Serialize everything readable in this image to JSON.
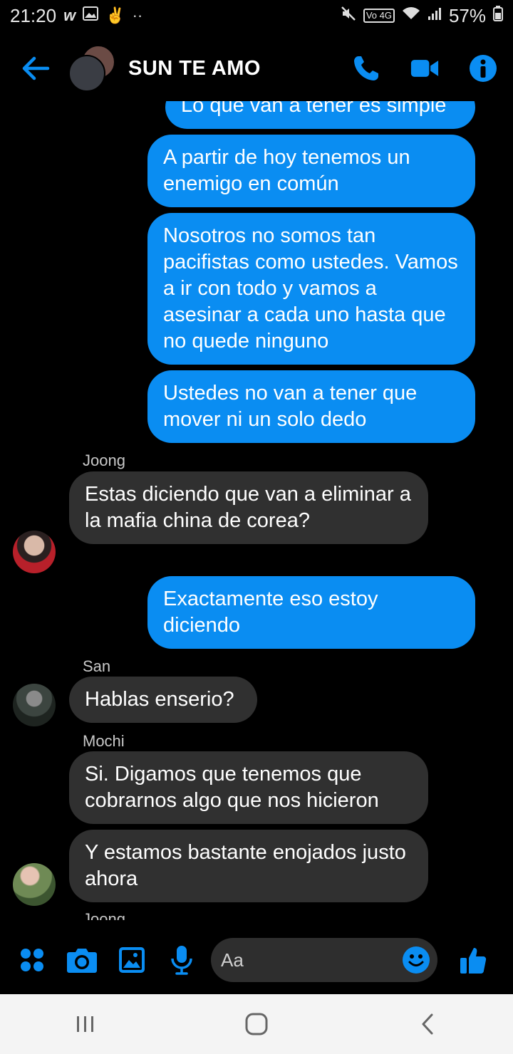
{
  "status_bar": {
    "time": "21:20",
    "battery": "57%",
    "network_badge": "Vo 4G",
    "left_icons": [
      "w-icon",
      "gallery-icon",
      "peace-hand-icon",
      "more-dots-icon"
    ],
    "right_icons": [
      "mute-icon",
      "volte-icon",
      "wifi-icon",
      "signal-icon",
      "battery-icon"
    ]
  },
  "header": {
    "title": "SUN TE AMO",
    "accent": "#0a8df2"
  },
  "messages": [
    {
      "dir": "out",
      "text": "Lo que van a tener es simple"
    },
    {
      "dir": "out",
      "text": "A partir de hoy tenemos un enemigo en común"
    },
    {
      "dir": "out",
      "text": "Nosotros no somos tan pacifistas como ustedes. Vamos a ir con todo y vamos a asesinar a cada uno hasta que no quede ninguno"
    },
    {
      "dir": "out",
      "text": "Ustedes no van a tener que mover ni un solo dedo"
    },
    {
      "dir": "in",
      "sender": "Joong",
      "text": "Estas diciendo que van a eliminar a la mafia china de corea?"
    },
    {
      "dir": "out",
      "text": "Exactamente eso estoy diciendo"
    },
    {
      "dir": "in",
      "sender": "San",
      "text": "Hablas enserio?"
    },
    {
      "dir": "in",
      "sender": "Mochi",
      "text": "Si. Digamos que tenemos que cobrarnos algo que nos hicieron"
    },
    {
      "dir": "in",
      "text": "Y estamos bastante enojados justo ahora"
    },
    {
      "dir": "in",
      "sender": "Joong",
      "text": ""
    }
  ],
  "composer": {
    "placeholder": "Aa"
  },
  "colors": {
    "outgoing_bubble": "#0a8df2",
    "incoming_bubble": "#303030",
    "background": "#000000",
    "nav_bar": "#f4f4f4"
  }
}
